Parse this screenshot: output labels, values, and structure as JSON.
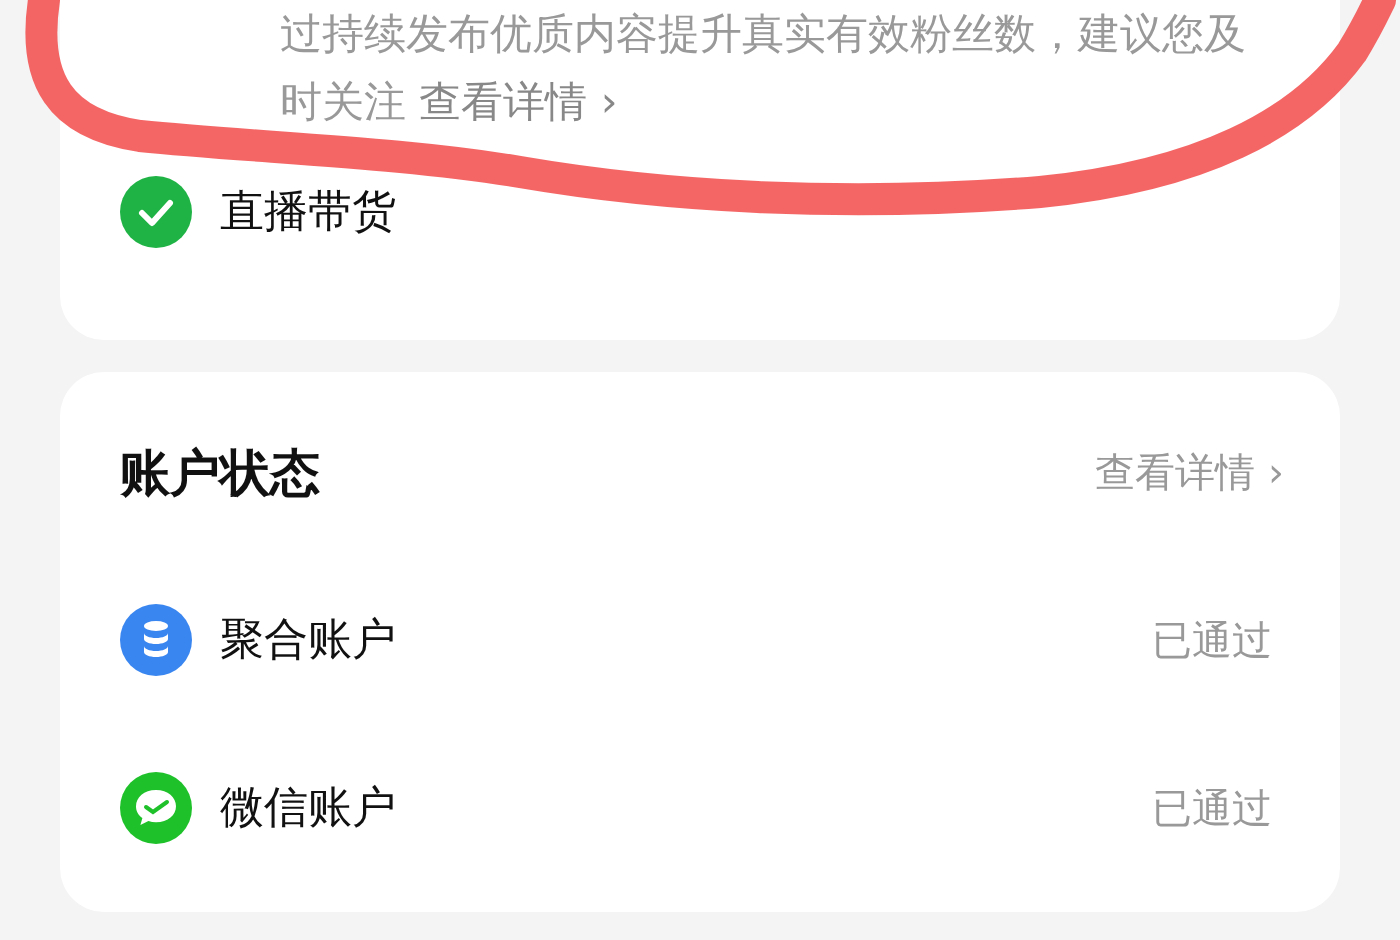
{
  "notice_card": {
    "description": "过持续发布优质内容提升真实有效粉丝数，建议您及时关注",
    "link": "查看详情 ›",
    "features": [
      {
        "label": "直播带货",
        "checked": true
      }
    ]
  },
  "account_status": {
    "title": "账户状态",
    "details_link": "查看详情 ›",
    "accounts": [
      {
        "kind": "stack",
        "name": "聚合账户",
        "status": "已通过"
      },
      {
        "kind": "chat",
        "name": "微信账户",
        "status": "已通过"
      }
    ]
  }
}
